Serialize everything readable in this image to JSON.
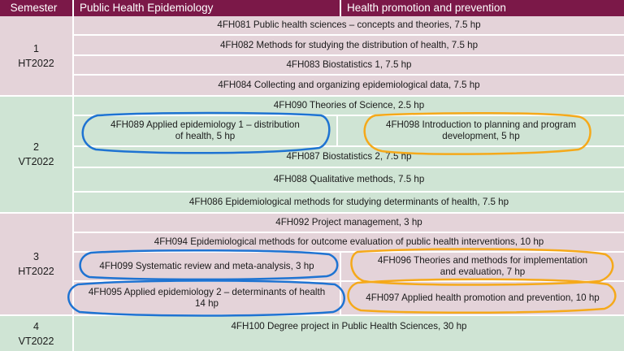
{
  "header": {
    "semester": "Semester",
    "track_left": "Public Health Epidemiology",
    "track_right": "Health promotion and prevention"
  },
  "semesters": [
    {
      "number": "1",
      "term": "HT2022"
    },
    {
      "number": "2",
      "term": "VT2022"
    },
    {
      "number": "3",
      "term": "HT2022"
    },
    {
      "number": "4",
      "term": "VT2022"
    }
  ],
  "courses": {
    "c081": "4FH081  Public health sciences – concepts and theories, 7.5 hp",
    "c082": "4FH082 Methods for studying the distribution of health, 7.5 hp",
    "c083": "4FH083 Biostatistics 1, 7.5 hp",
    "c084": "4FH084 Collecting and organizing epidemiological data, 7.5 hp",
    "c090": "4FH090 Theories of Science, 2.5 hp",
    "c089": "4FH089 Applied epidemiology 1 – distribution\nof health, 5 hp",
    "c098": "4FH098 Introduction to planning and program\ndevelopment, 5 hp",
    "c087": "4FH087 Biostatistics 2, 7.5 hp",
    "c088": "4FH088 Qualitative methods, 7.5 hp",
    "c086": "4FH086 Epidemiological methods for studying determinants of health, 7.5 hp",
    "c092": "4FH092 Project management, 3 hp",
    "c094": "4FH094 Epidemiological methods for outcome evaluation of public health interventions, 10 hp",
    "c099": "4FH099 Systematic review and meta-analysis, 3 hp",
    "c096": "4FH096 Theories and methods for implementation\nand evaluation, 7 hp",
    "c095": "4FH095 Applied epidemiology 2 – determinants of health\n14 hp",
    "c097": "4FH097 Applied health promotion and prevention, 10 hp",
    "c100": "4FH100 Degree project in Public Health Sciences, 30 hp"
  },
  "colors": {
    "header_bg": "#7b1848",
    "semester_odd": "#e4d3d9",
    "semester_even": "#cfe4d4",
    "highlight_epidemiology": "#1e73d2",
    "highlight_health_promotion": "#f5a91a"
  }
}
